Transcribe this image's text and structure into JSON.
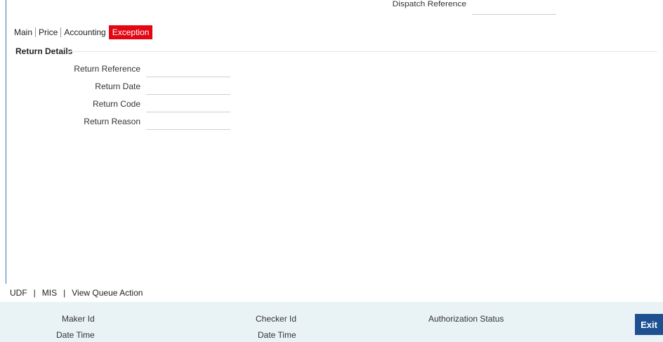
{
  "header": {
    "dispatch_reference_label": "Dispatch Reference",
    "dispatch_reference_value": ""
  },
  "tabs": [
    {
      "label": "Main",
      "active": false
    },
    {
      "label": "Price",
      "active": false
    },
    {
      "label": "Accounting",
      "active": false
    },
    {
      "label": "Exception",
      "active": true
    }
  ],
  "return_details": {
    "title": "Return Details",
    "fields": [
      {
        "label": "Return Reference",
        "value": ""
      },
      {
        "label": "Return Date",
        "value": ""
      },
      {
        "label": "Return Code",
        "value": ""
      },
      {
        "label": "Return Reason",
        "value": ""
      }
    ]
  },
  "footer_links": {
    "udf": "UDF",
    "mis": "MIS",
    "view_queue_action": "View Queue Action",
    "separator": "|"
  },
  "audit": {
    "maker_id_label": "Maker Id",
    "maker_date_time_label": "Date Time",
    "checker_id_label": "Checker Id",
    "checker_date_time_label": "Date Time",
    "authorization_status_label": "Authorization Status"
  },
  "buttons": {
    "exit_label": "Exit"
  },
  "colors": {
    "active_tab": "#e30613",
    "exit_button": "#1d4f91",
    "audit_bar": "#e9f3f6"
  }
}
